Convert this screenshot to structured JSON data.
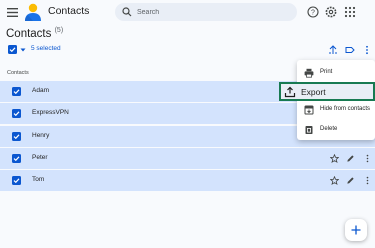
{
  "app": {
    "title": "Contacts",
    "brand_color": "#1a73e8"
  },
  "search": {
    "placeholder": "Search",
    "value": ""
  },
  "header": {
    "title": "Contacts",
    "count": "(5)"
  },
  "selection": {
    "label": "5 selected",
    "accent": "#0b57d0"
  },
  "list": {
    "column_label": "Contacts"
  },
  "contacts": [
    {
      "name": "Adam"
    },
    {
      "name": "ExpressVPN"
    },
    {
      "name": "Henry"
    },
    {
      "name": "Peter"
    },
    {
      "name": "Tom"
    }
  ],
  "menu": {
    "items": [
      {
        "label": "Print",
        "icon": "print-icon"
      },
      {
        "label": "Export",
        "icon": "export-icon",
        "highlighted": true
      },
      {
        "label": "Hide from contacts",
        "icon": "hide-icon"
      },
      {
        "label": "Delete",
        "icon": "delete-icon"
      }
    ],
    "highlight_color": "#187a52"
  },
  "colors": {
    "row_selected": "#d3e3fd",
    "background": "#f8fafd"
  }
}
